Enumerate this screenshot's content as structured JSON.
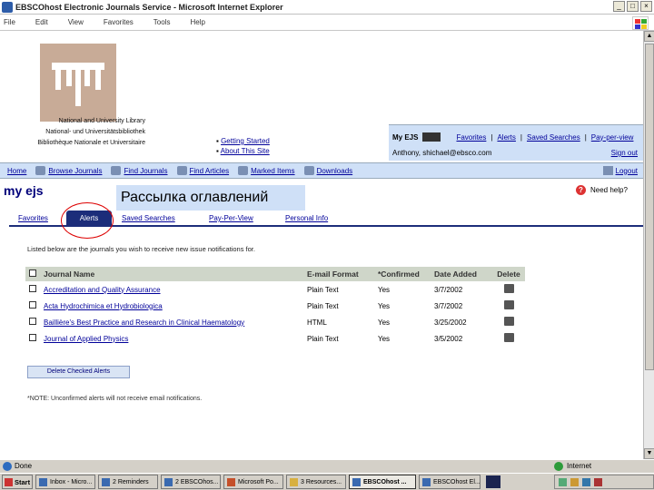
{
  "window": {
    "title": "EBSCOhost Electronic Journals Service - Microsoft Internet Explorer"
  },
  "menu": [
    "File",
    "Edit",
    "View",
    "Favorites",
    "Tools",
    "Help"
  ],
  "library": {
    "line1": "National and University Library",
    "line2": "National- und Universitätsbibliothek",
    "line3": "Bibliothèque Nationale et Universitaire"
  },
  "header_links": {
    "getting_started": "Getting Started",
    "about": "About This Site"
  },
  "account": {
    "label": "My EJS",
    "favorites": "Favorites",
    "alerts": "Alerts",
    "saved_searches": "Saved Searches",
    "pay_per_view": "Pay-per-view",
    "user": "Anthony, shichael@ebsco.com",
    "signout": "Sign out"
  },
  "nav": {
    "home": "Home",
    "browse": "Browse Journals",
    "find_journals": "Find Journals",
    "find_articles": "Find Articles",
    "marked": "Marked Items",
    "downloads": "Downloads",
    "logout": "Logout"
  },
  "page": {
    "title": "my ejs",
    "annotation": "Рассылка оглавлений",
    "help": "Need help?"
  },
  "tabs": [
    "Favorites",
    "Alerts",
    "Saved Searches",
    "Pay-Per-View",
    "Personal Info"
  ],
  "intro": "Listed below are the journals you wish to receive new issue notifications for.",
  "table": {
    "headers": [
      "Journal Name",
      "E-mail Format",
      "*Confirmed",
      "Date Added",
      "Delete"
    ],
    "rows": [
      {
        "name": "Accreditation and Quality Assurance",
        "format": "Plain Text",
        "confirmed": "Yes",
        "date": "3/7/2002"
      },
      {
        "name": "Acta Hydrochimica et Hydrobiologica",
        "format": "Plain Text",
        "confirmed": "Yes",
        "date": "3/7/2002"
      },
      {
        "name": "Baillière's Best Practice and Research in Clinical Haematology",
        "format": "HTML",
        "confirmed": "Yes",
        "date": "3/25/2002"
      },
      {
        "name": "Journal of Applied Physics",
        "format": "Plain Text",
        "confirmed": "Yes",
        "date": "3/5/2002"
      }
    ]
  },
  "delete_button": "Delete Checked Alerts",
  "note": "*NOTE: Unconfirmed alerts will not receive email notifications.",
  "status": {
    "left": "Done",
    "zone": "Internet"
  },
  "taskbar": {
    "start": "Start",
    "tasks": [
      "Inbox - Micro...",
      "2 Reminders",
      "2 EBSCOhos...",
      "Microsoft Po...",
      "3 Resources...",
      "EBSCOhost ...",
      "EBSCOhost El..."
    ]
  },
  "colors": {
    "accent_blue": "#1c2d7a",
    "panel_blue": "#cfe0f7",
    "link": "#00009a"
  }
}
